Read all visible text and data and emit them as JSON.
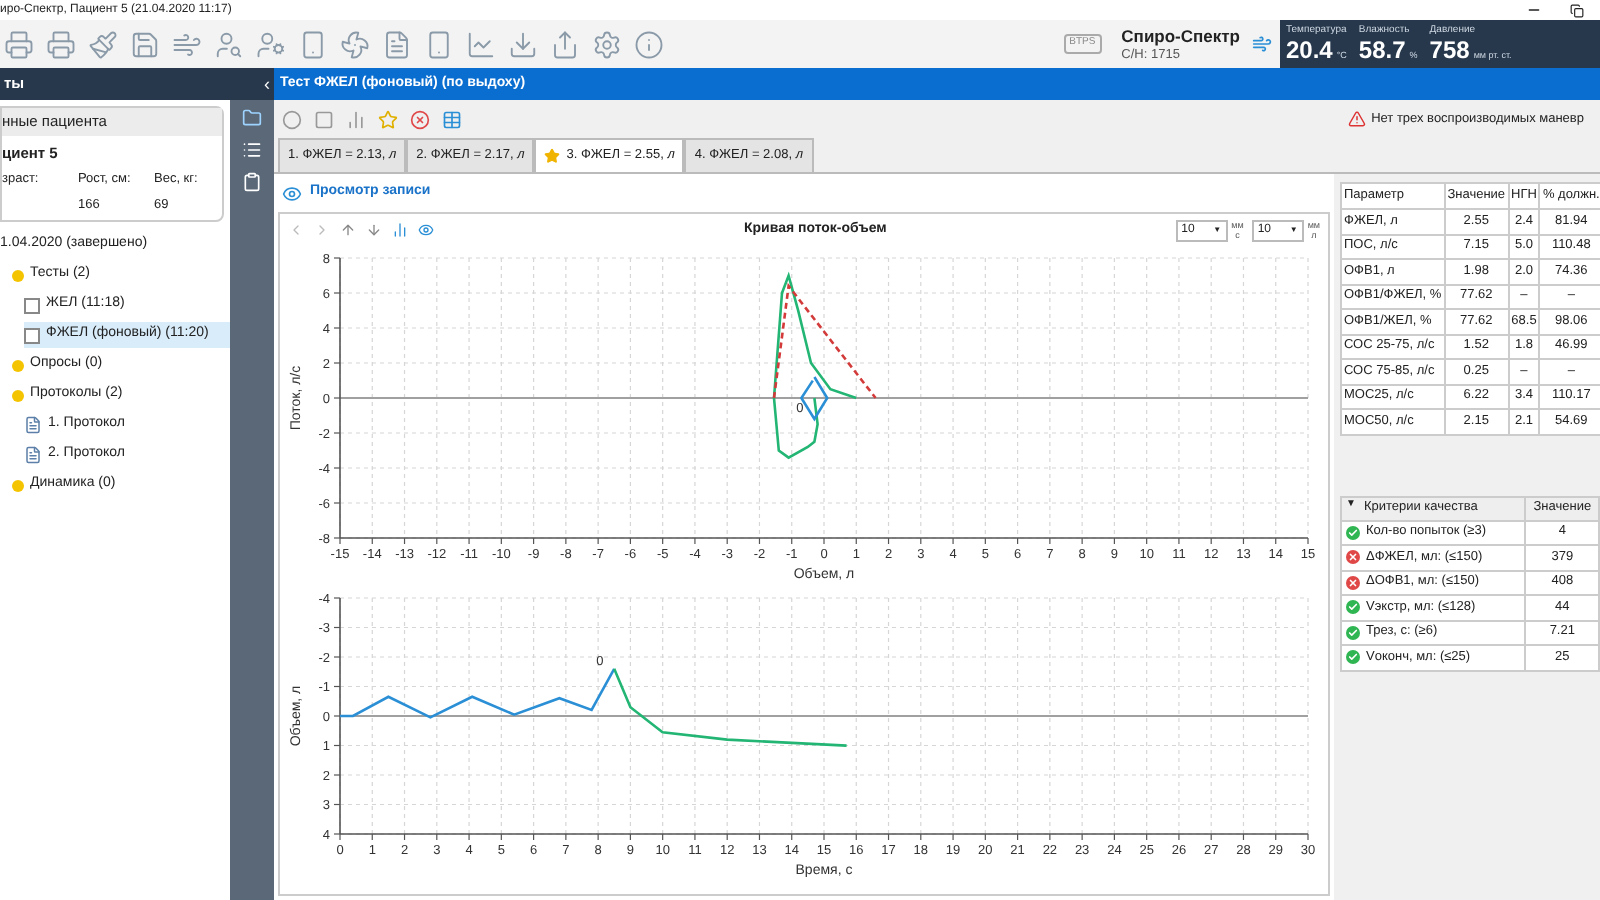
{
  "window": {
    "title": "иро-Спектр, Пациент 5 (21.04.2020 11:17)"
  },
  "device": {
    "badge": "BTPS",
    "name": "Спиро-Спектр",
    "serial": "С/Н: 1715"
  },
  "environment": [
    {
      "label": "Температура",
      "value": "20.4",
      "unit": "°C"
    },
    {
      "label": "Влажность",
      "value": "58.7",
      "unit": "%"
    },
    {
      "label": "Давление",
      "value": "758",
      "unit": "мм рт. ст."
    }
  ],
  "sidebar": {
    "title": "ты",
    "collapse": "‹",
    "patient": {
      "header": "нные пациента",
      "name": "циент 5",
      "fields": [
        {
          "label": "зраст:"
        },
        {
          "label": "Рост, см:",
          "value": "166"
        },
        {
          "label": "Вес, кг:",
          "value": "69"
        }
      ]
    },
    "tree": [
      {
        "label": "1.04.2020 (завершено)",
        "selected": false,
        "children": [
          {
            "label": "Тесты (2)",
            "kind": "folder",
            "selected": false,
            "children": [
              {
                "label": "ЖЕЛ (11:18)",
                "kind": "test",
                "selected": false
              },
              {
                "label": "ФЖЕЛ (фоновый) (11:20)",
                "kind": "test",
                "selected": true
              }
            ]
          },
          {
            "label": "Опросы (0)",
            "kind": "folder",
            "selected": false
          },
          {
            "label": "Протоколы (2)",
            "kind": "folder",
            "selected": false,
            "children": [
              {
                "label": "1. Протокол",
                "kind": "protocol",
                "selected": false
              },
              {
                "label": "2. Протокол",
                "kind": "protocol",
                "selected": false
              }
            ]
          },
          {
            "label": "Динамика (0)",
            "kind": "folder",
            "selected": false
          }
        ]
      }
    ]
  },
  "test": {
    "title": "Тест ФЖЕЛ (фоновый) (по выдоху)",
    "warning": "Нет трех воспроизводимых маневр",
    "tabs": [
      {
        "label": "1. ФЖЕЛ = 2.13, *л*",
        "selected": false,
        "starred": false
      },
      {
        "label": "2. ФЖЕЛ = 2.17, *л*",
        "selected": false,
        "starred": false
      },
      {
        "label": "3. ФЖЕЛ = 2.55, *л*",
        "selected": true,
        "starred": true
      },
      {
        "label": "4. ФЖЕЛ = 2.08, *л*",
        "selected": false,
        "starred": false
      }
    ],
    "view_link": "Просмотр записи",
    "chart_panel": {
      "title": "Кривая поток-объем",
      "scales": [
        {
          "value": "10",
          "arrow": "▼",
          "unit_top": "мм",
          "unit_bottom": "с"
        },
        {
          "value": "10",
          "arrow": "▼",
          "unit_top": "мм",
          "unit_bottom": "л"
        }
      ],
      "charts": [
        {
          "chart_data": {
            "type": "line",
            "grid": true,
            "xlabel": "Объем, л",
            "ylabel": "Поток, л/с",
            "xlim": [
              -15,
              15
            ],
            "ylim": [
              -8,
              8
            ],
            "xticks": [
              -15,
              -14,
              -13,
              -12,
              -11,
              -10,
              -9,
              -8,
              -7,
              -6,
              -5,
              -4,
              -3,
              -2,
              -1,
              0,
              1,
              2,
              3,
              4,
              5,
              6,
              7,
              8,
              9,
              10,
              11,
              12,
              13,
              14,
              15
            ],
            "yticks": [
              -8,
              -6,
              -4,
              -2,
              0,
              2,
              4,
              6,
              8
            ],
            "x": [
              -0.3,
              -0.2,
              -0.3,
              -0.5,
              -1.1,
              -1.4,
              -1.55,
              -1.3,
              -1.1,
              -0.8,
              -0.4,
              0.2,
              1.0,
              -1.55,
              -1.1,
              1.6,
              -0.3,
              0.1,
              -0.3,
              -0.7,
              -0.35
            ],
            "series": [
              {
                "color": "#22b573",
                "line_style": "solid",
                "values": [
                  0,
                  -1.5,
                  -2.5,
                  -2.8,
                  -3.4,
                  -3,
                  0,
                  6,
                  7,
                  5,
                  2,
                  0.5,
                  0,
                  null,
                  null,
                  null,
                  null,
                  null,
                  null,
                  null,
                  null
                ]
              },
              {
                "color": "#d33a3a",
                "line_style": "dashed",
                "values": [
                  null,
                  null,
                  null,
                  null,
                  null,
                  null,
                  null,
                  null,
                  null,
                  null,
                  null,
                  null,
                  null,
                  0,
                  6.4,
                  0,
                  null,
                  null,
                  null,
                  null,
                  null
                ]
              },
              {
                "color": "#2b8fd6",
                "line_style": "solid",
                "values": [
                  null,
                  null,
                  null,
                  null,
                  null,
                  null,
                  null,
                  null,
                  null,
                  null,
                  null,
                  null,
                  null,
                  null,
                  null,
                  null,
                  1.2,
                  0,
                  -1.2,
                  0,
                  1.0
                ]
              }
            ],
            "annotations": [
              {
                "x": -0.3,
                "y": -1,
                "text": "0"
              }
            ]
          }
        },
        {
          "chart_data": {
            "type": "line",
            "grid": true,
            "xlabel": "Время, с",
            "ylabel": "Объем, л",
            "xlim": [
              0,
              30
            ],
            "ylim": [
              4,
              -4
            ],
            "xticks": [
              0,
              1,
              2,
              3,
              4,
              5,
              6,
              7,
              8,
              9,
              10,
              11,
              12,
              13,
              14,
              15,
              16,
              17,
              18,
              19,
              20,
              21,
              22,
              23,
              24,
              25,
              26,
              27,
              28,
              29,
              30
            ],
            "yticks": [
              -4,
              -3,
              -2,
              -1,
              0,
              1,
              2,
              3,
              4
            ],
            "x": [
              0,
              0.4,
              1.5,
              2.8,
              4.1,
              5.4,
              6.8,
              7.8,
              8.5,
              8.5,
              9,
              10,
              12,
              15.7
            ],
            "series": [
              {
                "color": "#2b8fd6",
                "line_style": "solid",
                "values": [
                  0,
                  0,
                  -0.65,
                  0.05,
                  -0.65,
                  -0.05,
                  -0.6,
                  -0.2,
                  -1.6,
                  null,
                  null,
                  null,
                  null,
                  null
                ]
              },
              {
                "color": "#22b573",
                "line_style": "solid",
                "values": [
                  null,
                  null,
                  null,
                  null,
                  null,
                  null,
                  null,
                  null,
                  null,
                  -1.6,
                  -0.3,
                  0.55,
                  0.8,
                  1.0
                ]
              }
            ],
            "annotations": [
              {
                "x": 8.5,
                "y": -1.6,
                "text": "0"
              }
            ]
          }
        }
      ]
    }
  },
  "parameters": {
    "columns": [
      "Параметр",
      "Значение",
      "НГН",
      "% должн."
    ],
    "rows": [
      [
        "ФЖЕЛ, л",
        "2.55",
        "2.4",
        "81.94"
      ],
      [
        "ПОС, л/с",
        "7.15",
        "5.0",
        "110.48"
      ],
      [
        "ОФВ1, л",
        "1.98",
        "2.0",
        "74.36"
      ],
      [
        "ОФВ1/ФЖЕЛ, %",
        "77.62",
        "–",
        "–"
      ],
      [
        "ОФВ1/ЖЕЛ, %",
        "77.62",
        "68.5",
        "98.06"
      ],
      [
        "СОС 25-75, л/с",
        "1.52",
        "1.8",
        "46.99"
      ],
      [
        "СОС 75-85, л/с",
        "0.25",
        "–",
        "–"
      ],
      [
        "МОС25, л/с",
        "6.22",
        "3.4",
        "110.17"
      ],
      [
        "МОС50, л/с",
        "2.15",
        "2.1",
        "54.69"
      ]
    ]
  },
  "quality": {
    "toggle": "▼",
    "columns": [
      "Критерии качества",
      "Значение"
    ],
    "rows": [
      {
        "label": "Кол-во попыток (≥3)",
        "value": "4",
        "passed": true
      },
      {
        "label": "ΔФЖЕЛ, мл: (≤150)",
        "value": "379",
        "passed": false
      },
      {
        "label": "ΔОФВ1, мл: (≤150)",
        "value": "408",
        "passed": false
      },
      {
        "label": "Vэкстр, мл: (≤128)",
        "value": "44",
        "passed": true
      },
      {
        "label": "Трез, с: (≥6)",
        "value": "7.21",
        "passed": true
      },
      {
        "label": "Vоконч, мл: (≤25)",
        "value": "25",
        "passed": true
      }
    ]
  }
}
